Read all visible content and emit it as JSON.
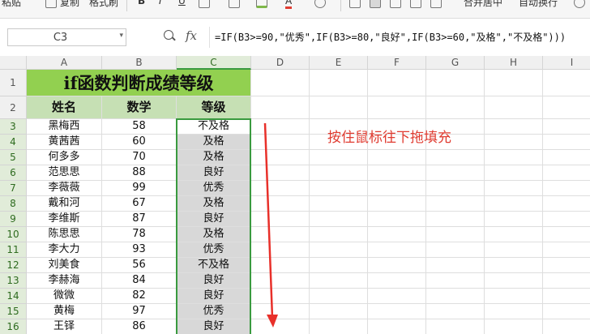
{
  "ribbon": {
    "paste": "粘贴",
    "copy": "复制",
    "format_painter": "格式刷",
    "merge_center": "合并居中",
    "wrap_text": "自动换行"
  },
  "formula_bar": {
    "name_box": "C3",
    "fx": "fx",
    "formula": "=IF(B3>=90,\"优秀\",IF(B3>=80,\"良好\",IF(B3>=60,\"及格\",\"不及格\")))"
  },
  "columns": [
    "A",
    "B",
    "C",
    "D",
    "E",
    "F",
    "G",
    "H",
    "I"
  ],
  "selected_column": "C",
  "rows": [
    "1",
    "2",
    "3",
    "4",
    "5",
    "6",
    "7",
    "8",
    "9",
    "10",
    "11",
    "12",
    "13",
    "14",
    "15",
    "16"
  ],
  "sheet": {
    "title": "if函数判断成绩等级",
    "headers": [
      "姓名",
      "数学",
      "等级"
    ],
    "records": [
      {
        "name": "黑梅西",
        "score": "58",
        "grade": "不及格"
      },
      {
        "name": "黄茜茜",
        "score": "60",
        "grade": "及格"
      },
      {
        "name": "何多多",
        "score": "70",
        "grade": "及格"
      },
      {
        "name": "范思思",
        "score": "88",
        "grade": "良好"
      },
      {
        "name": "李薇薇",
        "score": "99",
        "grade": "优秀"
      },
      {
        "name": "戴和河",
        "score": "67",
        "grade": "及格"
      },
      {
        "name": "李维斯",
        "score": "87",
        "grade": "良好"
      },
      {
        "name": "陈思思",
        "score": "78",
        "grade": "及格"
      },
      {
        "name": "李大力",
        "score": "93",
        "grade": "优秀"
      },
      {
        "name": "刘美食",
        "score": "56",
        "grade": "不及格"
      },
      {
        "name": "李赫海",
        "score": "84",
        "grade": "良好"
      },
      {
        "name": "微微",
        "score": "82",
        "grade": "良好"
      },
      {
        "name": "黄梅",
        "score": "97",
        "grade": "优秀"
      },
      {
        "name": "王铎",
        "score": "86",
        "grade": "良好"
      }
    ]
  },
  "annotation": "按住鼠标往下拖填充",
  "colors": {
    "title_fill": "#92d050",
    "header_fill": "#c6e0b4",
    "selection_border": "#3a9a3f",
    "selection_fill": "#d8d8d8",
    "annotation": "#e03c31"
  },
  "icons": [
    "paste-icon",
    "copy-icon",
    "format-painter-icon",
    "bold-icon",
    "italic-icon",
    "underline-icon",
    "border-icon",
    "fill-color-icon",
    "font-color-icon",
    "clear-icon",
    "align-left-icon",
    "align-center-icon",
    "align-right-icon",
    "justify-icon",
    "zoom-icon",
    "fx-icon",
    "down-arrow-icon"
  ]
}
